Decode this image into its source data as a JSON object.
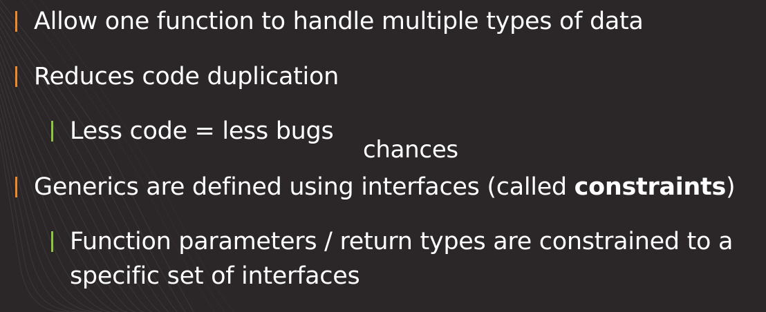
{
  "slide": {
    "bullets": [
      {
        "text": "Allow one function to handle multiple types of data"
      },
      {
        "text": "Reduces code duplication"
      },
      {
        "text": "Less code = less bugs"
      },
      {
        "text_before": "Generics are defined using interfaces (called ",
        "bold": "constraints",
        "text_after": ")"
      },
      {
        "text": "Function parameters / return types are constrained to a specific set of interfaces"
      }
    ],
    "annotation": "chances"
  },
  "colors": {
    "background": "#2b2628",
    "level1_bar": "#f0892a",
    "level2_bar": "#8cc63f",
    "text": "#ffffff"
  }
}
